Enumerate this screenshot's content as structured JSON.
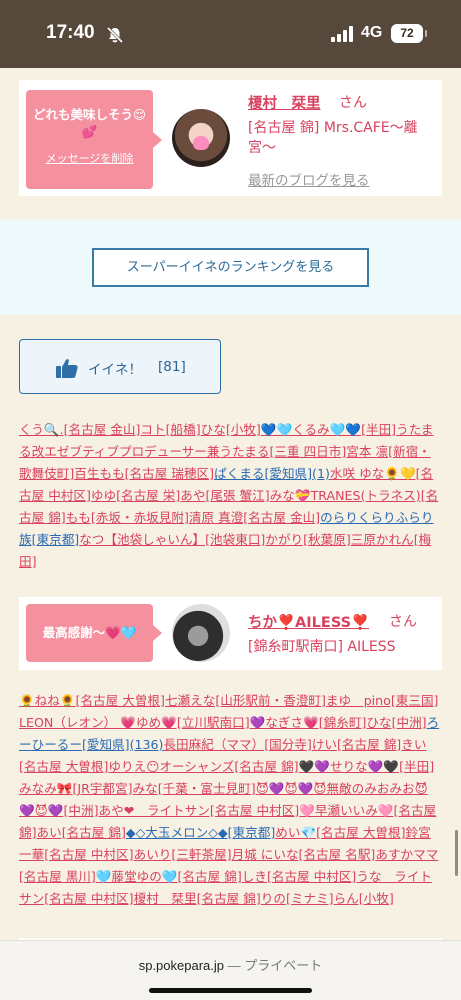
{
  "status_bar": {
    "time": "17:40",
    "network": "4G",
    "battery": "72"
  },
  "message_card_1": {
    "message": "どれも美味しそう😌💕",
    "delete_label": "メッセージを削除",
    "name": "榎村　栞里",
    "honorific": "さん",
    "shop": "[名古屋 錦] Mrs.CAFE～離宮～",
    "blog_link": "最新のブログを見る"
  },
  "ranking": {
    "button_label": "スーパーイイネのランキングを見る"
  },
  "like": {
    "label": "イイネ！",
    "count": "[81]"
  },
  "likers_1": [
    {
      "text": "くう🔍.[名古屋 金山]",
      "link": true
    },
    {
      "text": "コト[船橋]",
      "link": true
    },
    {
      "text": "ひな[小牧]",
      "link": true
    },
    {
      "text": "💙🩵くるみ🩵💙[半田]",
      "link": true
    },
    {
      "text": "うたまる改エゼブティブプロデューサー兼うたまる[三重 四日市]",
      "link": true
    },
    {
      "text": "宮本 凛[新宿・歌舞伎町]",
      "link": true
    },
    {
      "text": "百生もも[名古屋 瑞穂区]",
      "link": true
    },
    {
      "text": "ぱくまる[愛知県](1)",
      "link": true,
      "blue": true
    },
    {
      "text": "水咲 ゆな🌻💛[名古屋 中村区]",
      "link": true
    },
    {
      "text": "ゆゆ[名古屋 栄]",
      "link": true
    },
    {
      "text": "あや[尾張 蟹江]",
      "link": true
    },
    {
      "text": "みな💝TRANES(トラネス)[名古屋 錦]",
      "link": true
    },
    {
      "text": "もも[赤坂・赤坂見附]",
      "link": true
    },
    {
      "text": "清原 真澄[名古屋 金山]",
      "link": true
    },
    {
      "text": "のらりくらりふらり族[東京都]",
      "link": true,
      "blue": true
    },
    {
      "text": "なつ【池袋しゃいん】[池袋東口]",
      "link": true
    },
    {
      "text": "かがり[秋葉原]",
      "link": true
    },
    {
      "text": "三原かれん[梅田]",
      "link": true
    }
  ],
  "message_card_2": {
    "message": "最高感謝〜💗🩵",
    "name": "ちか❣️AILESS❣️",
    "honorific": "さん",
    "shop": "[錦糸町駅南口] AILESS"
  },
  "likers_2": [
    {
      "text": "🌻ねね🌻[名古屋 大曽根]",
      "link": true
    },
    {
      "text": "七瀬えな[山形駅前・香澄町]",
      "link": true
    },
    {
      "text": "まゆ　pino[東三国]",
      "link": true
    },
    {
      "text": "LEON（レオン） 💗ゆめ💗[立川駅南口]",
      "link": true
    },
    {
      "text": "💜なぎさ💗[錦糸町]",
      "link": true
    },
    {
      "text": "ひな[中洲]",
      "link": true
    },
    {
      "text": "ろーひーるー[愛知県](136)",
      "link": true,
      "blue": true
    },
    {
      "text": "長田麻紀（ママ）[国分寺]",
      "link": true
    },
    {
      "text": "けい[名古屋 錦]",
      "link": true
    },
    {
      "text": "きい[名古屋 大曽根]",
      "link": true
    },
    {
      "text": "ゆりえ😶オーシャンズ[名古屋 錦]",
      "link": true
    },
    {
      "text": "🖤💜せりな💜🖤[半田]",
      "link": true
    },
    {
      "text": "みなみ🎀[JR宇都宮]",
      "link": true
    },
    {
      "text": "みな[千葉・富士見町]",
      "link": true
    },
    {
      "text": "😈💜😈💜😈無敵のみおみお😈💜😈💜[中洲]",
      "link": true
    },
    {
      "text": "あや❤　ライトサン[名古屋 中村区]",
      "link": true
    },
    {
      "text": "🩷早瀬いいみ🩷[名古屋 錦]",
      "link": true
    },
    {
      "text": "あい[名古屋 錦]",
      "link": true
    },
    {
      "text": "◆◇大玉メロン◇◆[東京都]",
      "link": true,
      "blue": true
    },
    {
      "text": "めい💎[名古屋 大曽根]",
      "link": true
    },
    {
      "text": "鈴宮 一華[名古屋 中村区]",
      "link": true
    },
    {
      "text": "あいり[三軒茶屋]",
      "link": true
    },
    {
      "text": "月城 にいな[名古屋 名駅]",
      "link": true
    },
    {
      "text": "あすかママ[名古屋 黒川]",
      "link": true
    },
    {
      "text": "🩵藤堂ゆの🩵[名古屋 錦]",
      "link": true
    },
    {
      "text": "しき[名古屋 中村区]",
      "link": true
    },
    {
      "text": "うな　ライトサン[名古屋 中村区]",
      "link": true
    },
    {
      "text": "榎村　栞里[名古屋 錦]",
      "link": true
    },
    {
      "text": "りの[ミナミ]",
      "link": true
    },
    {
      "text": "らん[小牧]",
      "link": true
    }
  ],
  "browser": {
    "domain": "sp.pokepara.jp",
    "separator": "—",
    "privacy": "プライベート"
  },
  "colors": {
    "accent_pink": "#d9425f",
    "bubble_pink": "#f5909f",
    "link_blue": "#2a6ab2",
    "status_bar": "#56493c"
  }
}
